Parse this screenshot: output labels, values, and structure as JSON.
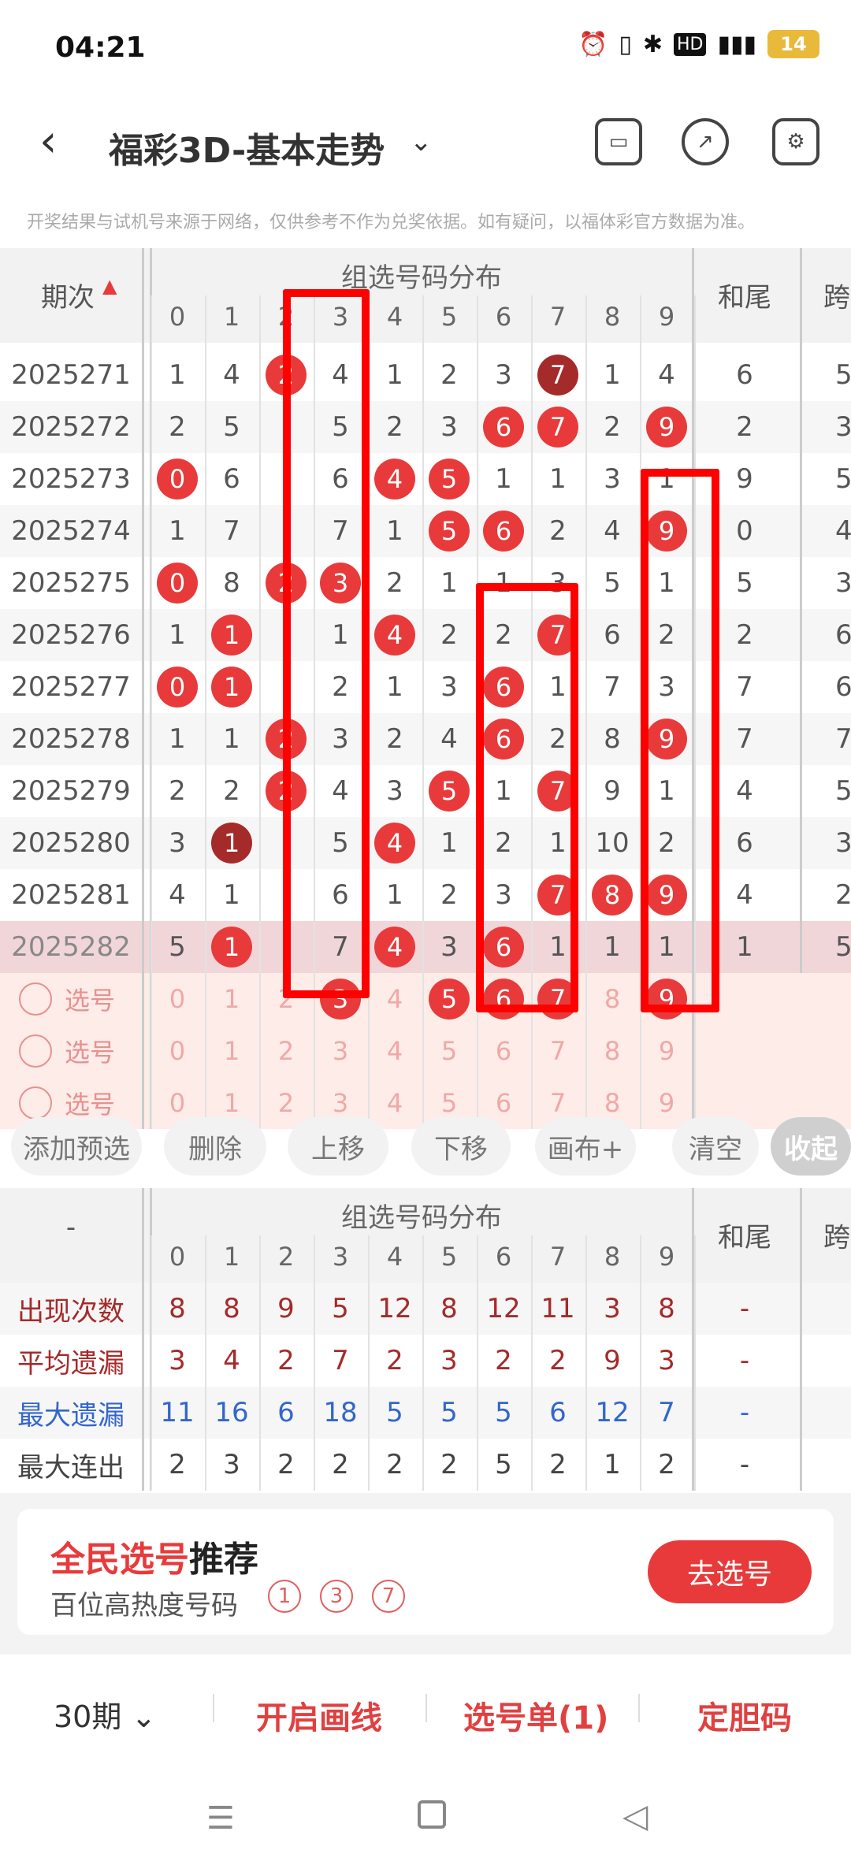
{
  "status": {
    "time": "04:21",
    "battery": "14",
    "icons": [
      "alarm-icon",
      "vibrate-icon",
      "bluetooth-icon",
      "hd-icon",
      "5g-signal-icon",
      "battery-icon"
    ]
  },
  "header": {
    "title": "福彩3D-基本走势",
    "icons": [
      "back-icon",
      "chevron-down-icon",
      "device-switch-icon",
      "share-icon",
      "settings-icon"
    ]
  },
  "disclaimer": "开奖结果与试机号来源于网络，仅供参考不作为兑奖依据。如有疑问，以福体彩官方数据为准。",
  "table1": {
    "col_issue": "期次",
    "group_title": "组选号码分布",
    "digits": [
      "0",
      "1",
      "2",
      "3",
      "4",
      "5",
      "6",
      "7",
      "8",
      "9"
    ],
    "col_tail": "和尾",
    "col_span": "跨",
    "rows": [
      {
        "issue": "2025271",
        "cells": [
          "1",
          "4",
          "",
          "4",
          "1",
          "2",
          "3",
          "7",
          "1",
          "4"
        ],
        "balls": [
          2,
          7
        ],
        "dark": [
          7
        ],
        "tail": "6",
        "span": "5"
      },
      {
        "issue": "2025272",
        "cells": [
          "2",
          "5",
          "",
          "5",
          "2",
          "3",
          "6",
          "7",
          "2",
          "9"
        ],
        "balls": [
          6,
          7,
          9
        ],
        "dark": [],
        "tail": "2",
        "span": "3"
      },
      {
        "issue": "2025273",
        "cells": [
          "0",
          "6",
          "",
          "6",
          "4",
          "5",
          "1",
          "1",
          "3",
          "1"
        ],
        "balls": [
          0,
          4,
          5
        ],
        "dark": [],
        "tail": "9",
        "span": "5"
      },
      {
        "issue": "2025274",
        "cells": [
          "1",
          "7",
          "",
          "7",
          "1",
          "5",
          "6",
          "2",
          "4",
          "9"
        ],
        "balls": [
          5,
          6,
          9
        ],
        "dark": [],
        "tail": "0",
        "span": "4"
      },
      {
        "issue": "2025275",
        "cells": [
          "0",
          "8",
          "",
          "3",
          "2",
          "1",
          "1",
          "3",
          "5",
          "1"
        ],
        "balls": [
          0,
          2,
          3
        ],
        "dark": [],
        "tail": "5",
        "span": "3"
      },
      {
        "issue": "2025276",
        "cells": [
          "1",
          "1",
          "",
          "1",
          "4",
          "2",
          "2",
          "7",
          "6",
          "2"
        ],
        "balls": [
          1,
          4,
          7
        ],
        "dark": [],
        "tail": "2",
        "span": "6"
      },
      {
        "issue": "2025277",
        "cells": [
          "0",
          "1",
          "",
          "2",
          "1",
          "3",
          "6",
          "1",
          "7",
          "3"
        ],
        "balls": [
          0,
          1,
          6
        ],
        "dark": [],
        "tail": "7",
        "span": "6"
      },
      {
        "issue": "2025278",
        "cells": [
          "1",
          "1",
          "",
          "3",
          "2",
          "4",
          "6",
          "2",
          "8",
          "9"
        ],
        "balls": [
          2,
          6,
          9
        ],
        "dark": [],
        "tail": "7",
        "span": "7"
      },
      {
        "issue": "2025279",
        "cells": [
          "2",
          "2",
          "",
          "4",
          "3",
          "5",
          "1",
          "7",
          "9",
          "1"
        ],
        "balls": [
          2,
          5,
          7
        ],
        "dark": [],
        "tail": "4",
        "span": "5"
      },
      {
        "issue": "2025280",
        "cells": [
          "3",
          "1",
          "",
          "5",
          "4",
          "1",
          "2",
          "1",
          "10",
          "2"
        ],
        "balls": [
          1,
          4
        ],
        "dark": [
          1
        ],
        "tail": "6",
        "span": "3"
      },
      {
        "issue": "2025281",
        "cells": [
          "4",
          "1",
          "",
          "6",
          "1",
          "2",
          "3",
          "7",
          "8",
          "9"
        ],
        "balls": [
          7,
          8,
          9
        ],
        "dark": [],
        "tail": "4",
        "span": "2"
      },
      {
        "issue": "2025282",
        "cells": [
          "5",
          "1",
          "",
          "7",
          "4",
          "3",
          "6",
          "1",
          "1",
          "1"
        ],
        "balls": [
          1,
          4,
          6
        ],
        "dark": [],
        "tail": "1",
        "span": "5"
      }
    ],
    "pick_label": "选号",
    "pick_rows": [
      {
        "balls": [
          3,
          5,
          6,
          7,
          9
        ]
      },
      {
        "balls": []
      },
      {
        "balls": []
      }
    ]
  },
  "buttons": [
    "添加预选",
    "删除",
    "上移",
    "下移",
    "画布+",
    "清空",
    "收起"
  ],
  "table2": {
    "corner": "-",
    "group_title": "组选号码分布",
    "digits": [
      "0",
      "1",
      "2",
      "3",
      "4",
      "5",
      "6",
      "7",
      "8",
      "9"
    ],
    "col_tail": "和尾",
    "col_span": "跨",
    "stats": [
      {
        "label": "出现次数",
        "color": "#a52a2a",
        "values": [
          "8",
          "8",
          "9",
          "5",
          "12",
          "8",
          "12",
          "11",
          "3",
          "8"
        ],
        "tail": "-"
      },
      {
        "label": "平均遗漏",
        "color": "#a52a2a",
        "values": [
          "3",
          "4",
          "2",
          "7",
          "2",
          "3",
          "2",
          "2",
          "9",
          "3"
        ],
        "tail": "-"
      },
      {
        "label": "最大遗漏",
        "color": "#3366cc",
        "values": [
          "11",
          "16",
          "6",
          "18",
          "5",
          "5",
          "5",
          "6",
          "12",
          "7"
        ],
        "tail": "-"
      },
      {
        "label": "最大连出",
        "color": "#444444",
        "values": [
          "2",
          "3",
          "2",
          "2",
          "2",
          "2",
          "5",
          "2",
          "1",
          "2"
        ],
        "tail": "-"
      }
    ]
  },
  "recommend": {
    "title_red": "全民选号",
    "title_black": "推荐",
    "subtitle": "百位高热度号码",
    "numbers": [
      "1",
      "3",
      "7"
    ],
    "button": "去选号"
  },
  "bottom": {
    "period": "30期",
    "draw": "开启画线",
    "list": "选号单(1)",
    "fixed": "定胆码"
  },
  "colors": {
    "accent": "#e83a3a",
    "pick_bg": "#fdece8"
  }
}
